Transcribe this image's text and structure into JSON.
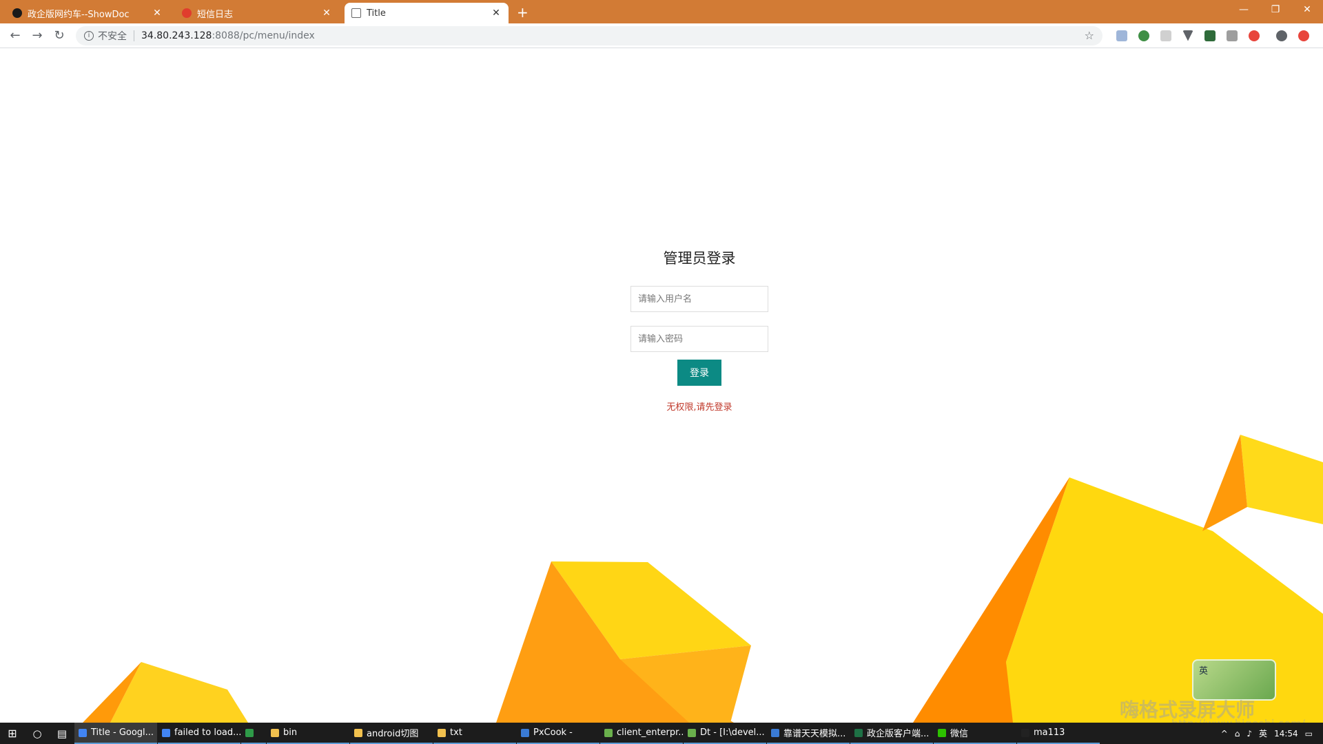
{
  "browser": {
    "tabs": [
      {
        "label": "政企版网约车--ShowDoc",
        "favicon_color": "#1a1a1a",
        "active": false
      },
      {
        "label": "短信日志",
        "favicon_color": "#e03d2d",
        "active": false
      },
      {
        "label": "Title",
        "favicon_color": "#666666",
        "active": true
      }
    ],
    "new_tab_label": "+",
    "close_glyph": "✕",
    "window_controls": [
      "—",
      "❐",
      "✕"
    ],
    "omnibox": {
      "security_text": "不安全",
      "url_host": "34.80.243.128",
      "url_path": ":8088/pc/menu/index"
    }
  },
  "login": {
    "title": "管理员登录",
    "username_placeholder": "请输入用户名",
    "password_placeholder": "请输入密码",
    "submit_label": "登录",
    "error_message": "无权限,请先登录",
    "button_color": "#0c8a84",
    "error_color": "#c0392b"
  },
  "overlay": {
    "ime_label": "英",
    "watermark": "嗨格式录屏大师",
    "watermark_url": "http://www.higeshi.com/"
  },
  "taskbar": {
    "items": [
      {
        "label": "Title - Googl...",
        "icon_color": "#4285f4",
        "active": true
      },
      {
        "label": "failed to load...",
        "icon_color": "#4285f4",
        "active": false
      },
      {
        "label": "",
        "icon_color": "#2e9a48",
        "active": false
      },
      {
        "label": "bin",
        "icon_color": "#f2c14e",
        "active": false
      },
      {
        "label": "android切图",
        "icon_color": "#f2c14e",
        "active": false
      },
      {
        "label": "txt",
        "icon_color": "#f2c14e",
        "active": false
      },
      {
        "label": "PxCook -",
        "icon_color": "#3a7bd5",
        "active": false
      },
      {
        "label": "client_enterpr...",
        "icon_color": "#6ab04c",
        "active": false
      },
      {
        "label": "Dt - [I:\\devel...",
        "icon_color": "#6ab04c",
        "active": false
      },
      {
        "label": "靠谱天天模拟...",
        "icon_color": "#3a7bd5",
        "active": false
      },
      {
        "label": "政企版客户端...",
        "icon_color": "#1e7145",
        "active": false
      },
      {
        "label": "微信",
        "icon_color": "#2dc100",
        "active": false
      },
      {
        "label": "ma113",
        "icon_color": "#222222",
        "active": false
      }
    ],
    "tray": {
      "ime": "英",
      "time": "14:54"
    }
  }
}
